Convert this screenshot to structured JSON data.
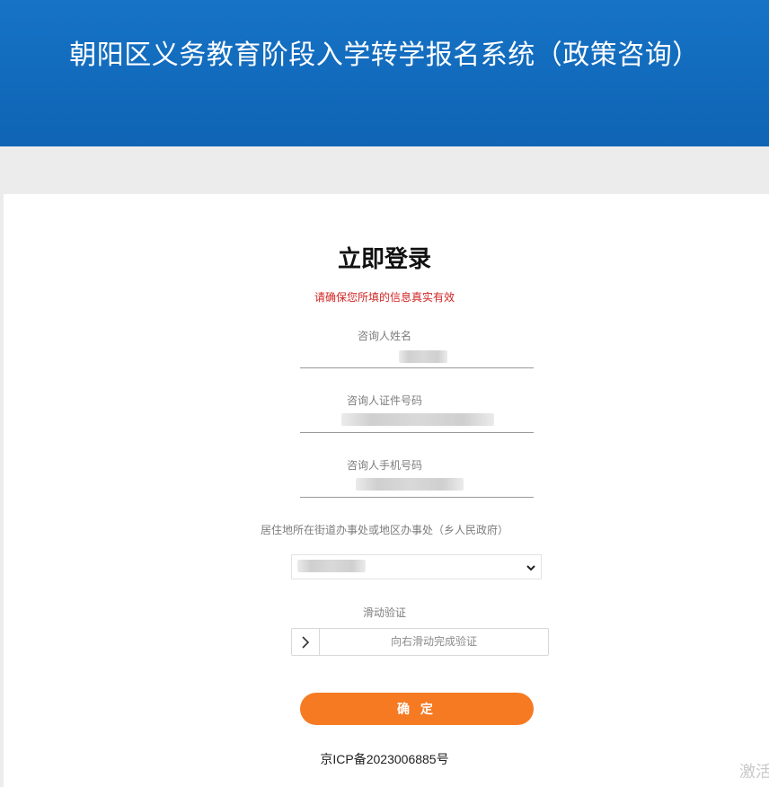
{
  "header": {
    "title": "朝阳区义务教育阶段入学转学报名系统（政策咨询）"
  },
  "login": {
    "title": "立即登录",
    "notice": "请确保您所填的信息真实有效",
    "fields": {
      "name_label": "咨询人姓名",
      "id_label": "咨询人证件号码",
      "phone_label": "咨询人手机号码",
      "district_label": "居住地所在街道办事处或地区办事处（乡人民政府）"
    },
    "slider": {
      "label": "滑动验证",
      "hint": "向右滑动完成验证"
    },
    "confirm": "确 定"
  },
  "footer": {
    "icp": "京ICP备2023006885号"
  },
  "watermark": "激活"
}
